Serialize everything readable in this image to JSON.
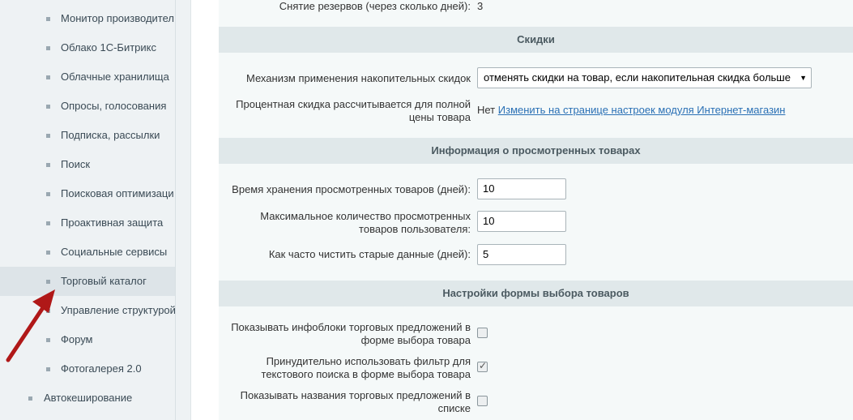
{
  "sidebar": {
    "items": [
      {
        "label": "Монитор производител"
      },
      {
        "label": "Облако 1С-Битрикс"
      },
      {
        "label": "Облачные хранилища"
      },
      {
        "label": "Опросы, голосования"
      },
      {
        "label": "Подписка, рассылки"
      },
      {
        "label": "Поиск"
      },
      {
        "label": "Поисковая оптимизаци"
      },
      {
        "label": "Проактивная защита"
      },
      {
        "label": "Социальные сервисы"
      },
      {
        "label": "Торговый каталог"
      },
      {
        "label": "Управление структурой"
      },
      {
        "label": "Форум"
      },
      {
        "label": "Фотогалерея 2.0"
      },
      {
        "label": "Автокеширование"
      }
    ]
  },
  "settings": {
    "reserve_removal": {
      "label": "Снятие резервов (через сколько дней):",
      "value": "3"
    },
    "discounts": {
      "title": "Скидки",
      "mechanism_label": "Механизм применения накопительных скидок",
      "mechanism_value": "отменять скидки на товар, если накопительная скидка больше",
      "percent_label_line1": "Процентная скидка рассчитывается для полной",
      "percent_label_line2": "цены товара",
      "percent_value": "Нет",
      "percent_link": "Изменить на странице настроек модуля Интернет-магазин"
    },
    "viewed": {
      "title": "Информация о просмотренных товарах",
      "storage_label": "Время хранения просмотренных товаров (дней):",
      "storage_value": "10",
      "max_label_line1": "Максимальное количество просмотренных",
      "max_label_line2": "товаров пользователя:",
      "max_value": "10",
      "clean_label": "Как часто чистить старые данные (дней):",
      "clean_value": "5"
    },
    "form": {
      "title": "Настройки формы выбора товаров",
      "iblocks_label_line1": "Показывать инфоблоки торговых предложений в",
      "iblocks_label_line2": "форме выбора товара",
      "iblocks_checked": false,
      "filter_label_line1": "Принудительно использовать фильтр для",
      "filter_label_line2": "текстового поиска в форме выбора товара",
      "filter_checked": true,
      "names_label_line1": "Показывать названия торговых предложений в",
      "names_label_line2": "списке",
      "names_checked": false
    }
  },
  "colors": {
    "annotation_arrow": "#b01818",
    "link": "#2a70b5"
  }
}
